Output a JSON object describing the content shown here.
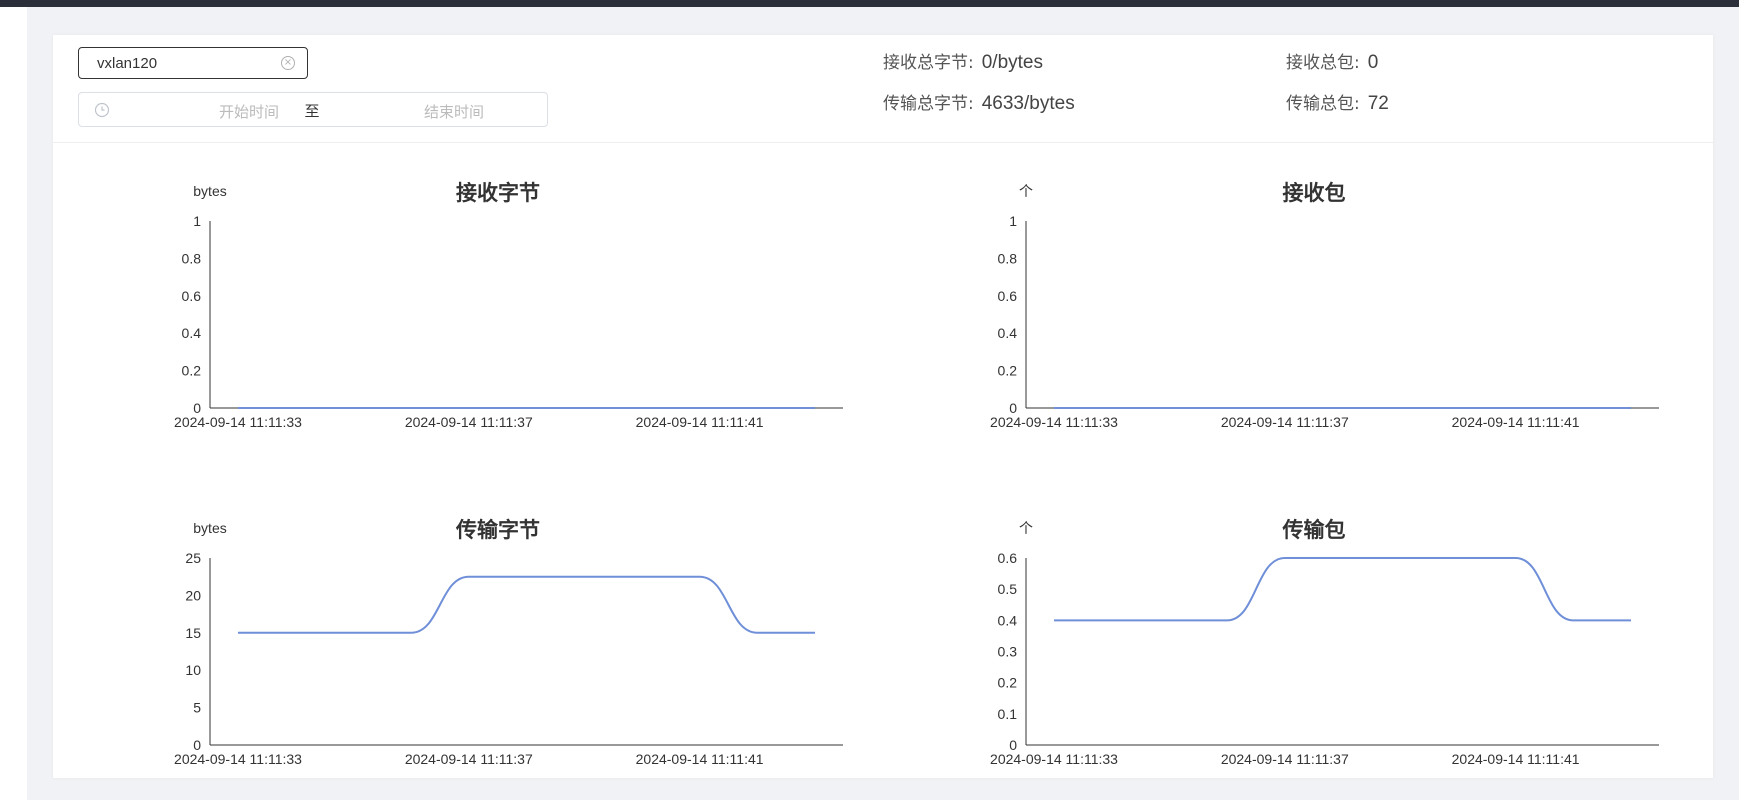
{
  "filter": {
    "interface_value": "vxlan120",
    "start_placeholder": "开始时间",
    "range_separator": "至",
    "end_placeholder": "结束时间"
  },
  "stats": {
    "rx_bytes": {
      "label": "接收总字节:",
      "value": "0/bytes"
    },
    "tx_bytes": {
      "label": "传输总字节:",
      "value": "4633/bytes"
    },
    "rx_packets": {
      "label": "接收总包:",
      "value": "0"
    },
    "tx_packets": {
      "label": "传输总包:",
      "value": "72"
    }
  },
  "colors": {
    "series": "#6f8fd8",
    "axis": "#333333"
  },
  "chart_data": [
    {
      "type": "line",
      "title": "接收字节",
      "ylabel": "bytes",
      "ylim": [
        0,
        1
      ],
      "yticks": [
        "0",
        "0.2",
        "0.4",
        "0.6",
        "0.8",
        "1"
      ],
      "xticks": [
        "2024-09-14 11:11:33",
        "2024-09-14 11:11:37",
        "2024-09-14 11:11:41"
      ],
      "x": [
        "11:11:33",
        "11:11:34",
        "11:11:35",
        "11:11:36",
        "11:11:37",
        "11:11:38",
        "11:11:39",
        "11:11:40",
        "11:11:41",
        "11:11:42",
        "11:11:43"
      ],
      "series": [
        {
          "values": [
            0,
            0,
            0,
            0,
            0,
            0,
            0,
            0,
            0,
            0,
            0
          ]
        }
      ]
    },
    {
      "type": "line",
      "title": "接收包",
      "ylabel": "个",
      "ylim": [
        0,
        1
      ],
      "yticks": [
        "0",
        "0.2",
        "0.4",
        "0.6",
        "0.8",
        "1"
      ],
      "xticks": [
        "2024-09-14 11:11:33",
        "2024-09-14 11:11:37",
        "2024-09-14 11:11:41"
      ],
      "x": [
        "11:11:33",
        "11:11:34",
        "11:11:35",
        "11:11:36",
        "11:11:37",
        "11:11:38",
        "11:11:39",
        "11:11:40",
        "11:11:41",
        "11:11:42",
        "11:11:43"
      ],
      "series": [
        {
          "values": [
            0,
            0,
            0,
            0,
            0,
            0,
            0,
            0,
            0,
            0,
            0
          ]
        }
      ]
    },
    {
      "type": "line",
      "title": "传输字节",
      "ylabel": "bytes",
      "ylim": [
        0,
        25
      ],
      "yticks": [
        "0",
        "5",
        "10",
        "15",
        "20",
        "25"
      ],
      "xticks": [
        "2024-09-14 11:11:33",
        "2024-09-14 11:11:37",
        "2024-09-14 11:11:41"
      ],
      "x": [
        "11:11:33",
        "11:11:34",
        "11:11:35",
        "11:11:36",
        "11:11:37",
        "11:11:38",
        "11:11:39",
        "11:11:40",
        "11:11:41",
        "11:11:42",
        "11:11:43"
      ],
      "series": [
        {
          "values": [
            15,
            15,
            15,
            15,
            22.5,
            22.5,
            22.5,
            22.5,
            22.5,
            15,
            15
          ]
        }
      ]
    },
    {
      "type": "line",
      "title": "传输包",
      "ylabel": "个",
      "ylim": [
        0,
        0.6
      ],
      "yticks": [
        "0",
        "0.1",
        "0.2",
        "0.3",
        "0.4",
        "0.5",
        "0.6"
      ],
      "xticks": [
        "2024-09-14 11:11:33",
        "2024-09-14 11:11:37",
        "2024-09-14 11:11:41"
      ],
      "x": [
        "11:11:33",
        "11:11:34",
        "11:11:35",
        "11:11:36",
        "11:11:37",
        "11:11:38",
        "11:11:39",
        "11:11:40",
        "11:11:41",
        "11:11:42",
        "11:11:43"
      ],
      "series": [
        {
          "values": [
            0.4,
            0.4,
            0.4,
            0.4,
            0.6,
            0.6,
            0.6,
            0.6,
            0.6,
            0.4,
            0.4
          ]
        }
      ]
    }
  ]
}
